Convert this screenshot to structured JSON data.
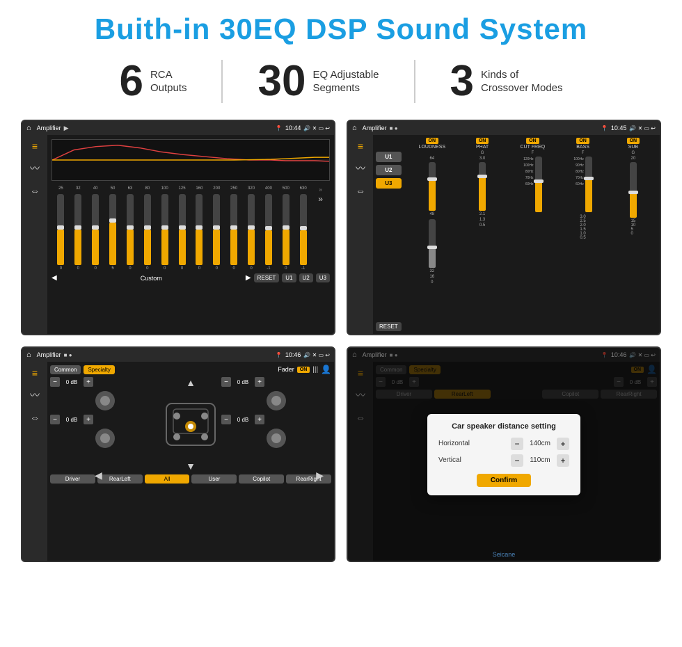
{
  "header": {
    "title": "Buith-in 30EQ DSP Sound System"
  },
  "stats": [
    {
      "num": "6",
      "label": "RCA\nOutputs"
    },
    {
      "num": "30",
      "label": "EQ Adjustable\nSegments"
    },
    {
      "num": "3",
      "label": "Kinds of\nCrossover Modes"
    }
  ],
  "screens": {
    "screen1": {
      "title": "Amplifier",
      "time": "10:44",
      "eq_freqs": [
        "25",
        "32",
        "40",
        "50",
        "63",
        "80",
        "100",
        "125",
        "160",
        "200",
        "250",
        "320",
        "400",
        "500",
        "630"
      ],
      "eq_vals": [
        "0",
        "0",
        "0",
        "5",
        "0",
        "0",
        "0",
        "0",
        "0",
        "0",
        "0",
        "0",
        "-1",
        "0",
        "-1"
      ],
      "eq_preset": "Custom",
      "buttons": [
        "RESET",
        "U1",
        "U2",
        "U3"
      ]
    },
    "screen2": {
      "title": "Amplifier",
      "time": "10:45",
      "presets": [
        "U1",
        "U2",
        "U3"
      ],
      "channels": [
        "LOUDNESS",
        "PHAT",
        "CUT FREQ",
        "BASS",
        "SUB"
      ],
      "reset_label": "RESET"
    },
    "screen3": {
      "title": "Amplifier",
      "time": "10:46",
      "tabs": [
        "Common",
        "Specialty"
      ],
      "fader_label": "Fader",
      "buttons": [
        "Driver",
        "RearLeft",
        "All",
        "User",
        "Copilot",
        "RearRight"
      ],
      "db_values": [
        "0 dB",
        "0 dB",
        "0 dB",
        "0 dB"
      ]
    },
    "screen4": {
      "title": "Amplifier",
      "time": "10:46",
      "dialog": {
        "title": "Car speaker distance setting",
        "horizontal_label": "Horizontal",
        "horizontal_val": "140cm",
        "vertical_label": "Vertical",
        "vertical_val": "110cm",
        "confirm_label": "Confirm"
      }
    }
  },
  "watermark": "Seicane"
}
